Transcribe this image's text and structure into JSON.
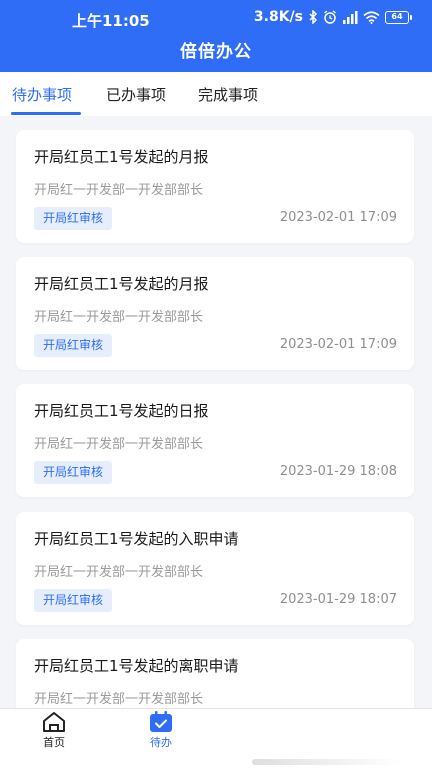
{
  "status": {
    "time": "上午11:05",
    "network_speed": "3.8K/s",
    "battery": "64"
  },
  "header": {
    "title": "倍倍办公"
  },
  "tabs": [
    {
      "label": "待办事项",
      "active": true
    },
    {
      "label": "已办事项",
      "active": false
    },
    {
      "label": "完成事项",
      "active": false
    }
  ],
  "items": [
    {
      "title": "开局红员工1号发起的月报",
      "subtitle": "开局红一开发部一开发部部长",
      "badge": "开局红审核",
      "time": "2023-02-01 17:09"
    },
    {
      "title": "开局红员工1号发起的月报",
      "subtitle": "开局红一开发部一开发部部长",
      "badge": "开局红审核",
      "time": "2023-02-01 17:09"
    },
    {
      "title": "开局红员工1号发起的日报",
      "subtitle": "开局红一开发部一开发部部长",
      "badge": "开局红审核",
      "time": "2023-01-29 18:08"
    },
    {
      "title": "开局红员工1号发起的入职申请",
      "subtitle": "开局红一开发部一开发部部长",
      "badge": "开局红审核",
      "time": "2023-01-29 18:07"
    },
    {
      "title": "开局红员工1号发起的离职申请",
      "subtitle": "开局红一开发部一开发部部长",
      "badge": "",
      "time": ""
    }
  ],
  "bottom_nav": [
    {
      "label": "首页",
      "icon": "home-icon",
      "active": false
    },
    {
      "label": "待办",
      "icon": "calendar-check-icon",
      "active": true
    }
  ],
  "colors": {
    "primary": "#2f6df6",
    "badge_bg": "#e6eefc",
    "page_bg": "#f3f5f8"
  }
}
